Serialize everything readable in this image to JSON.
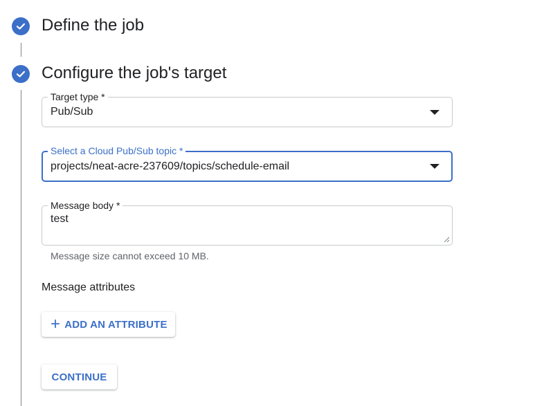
{
  "steps": [
    {
      "title": "Define the job",
      "status": "complete"
    },
    {
      "title": "Configure the job's target",
      "status": "complete"
    }
  ],
  "target_type": {
    "label": "Target type *",
    "value": "Pub/Sub"
  },
  "topic": {
    "label": "Select a Cloud Pub/Sub topic *",
    "value": "projects/neat-acre-237609/topics/schedule-email"
  },
  "message_body": {
    "label": "Message body *",
    "value": "test",
    "hint": "Message size cannot exceed 10 MB."
  },
  "attributes": {
    "label": "Message attributes",
    "add_button": "ADD AN ATTRIBUTE"
  },
  "continue_button": "CONTINUE",
  "colors": {
    "accent": "#3b6fc8",
    "text": "#202124",
    "muted": "#5f6368",
    "border": "#c7c9cc"
  }
}
